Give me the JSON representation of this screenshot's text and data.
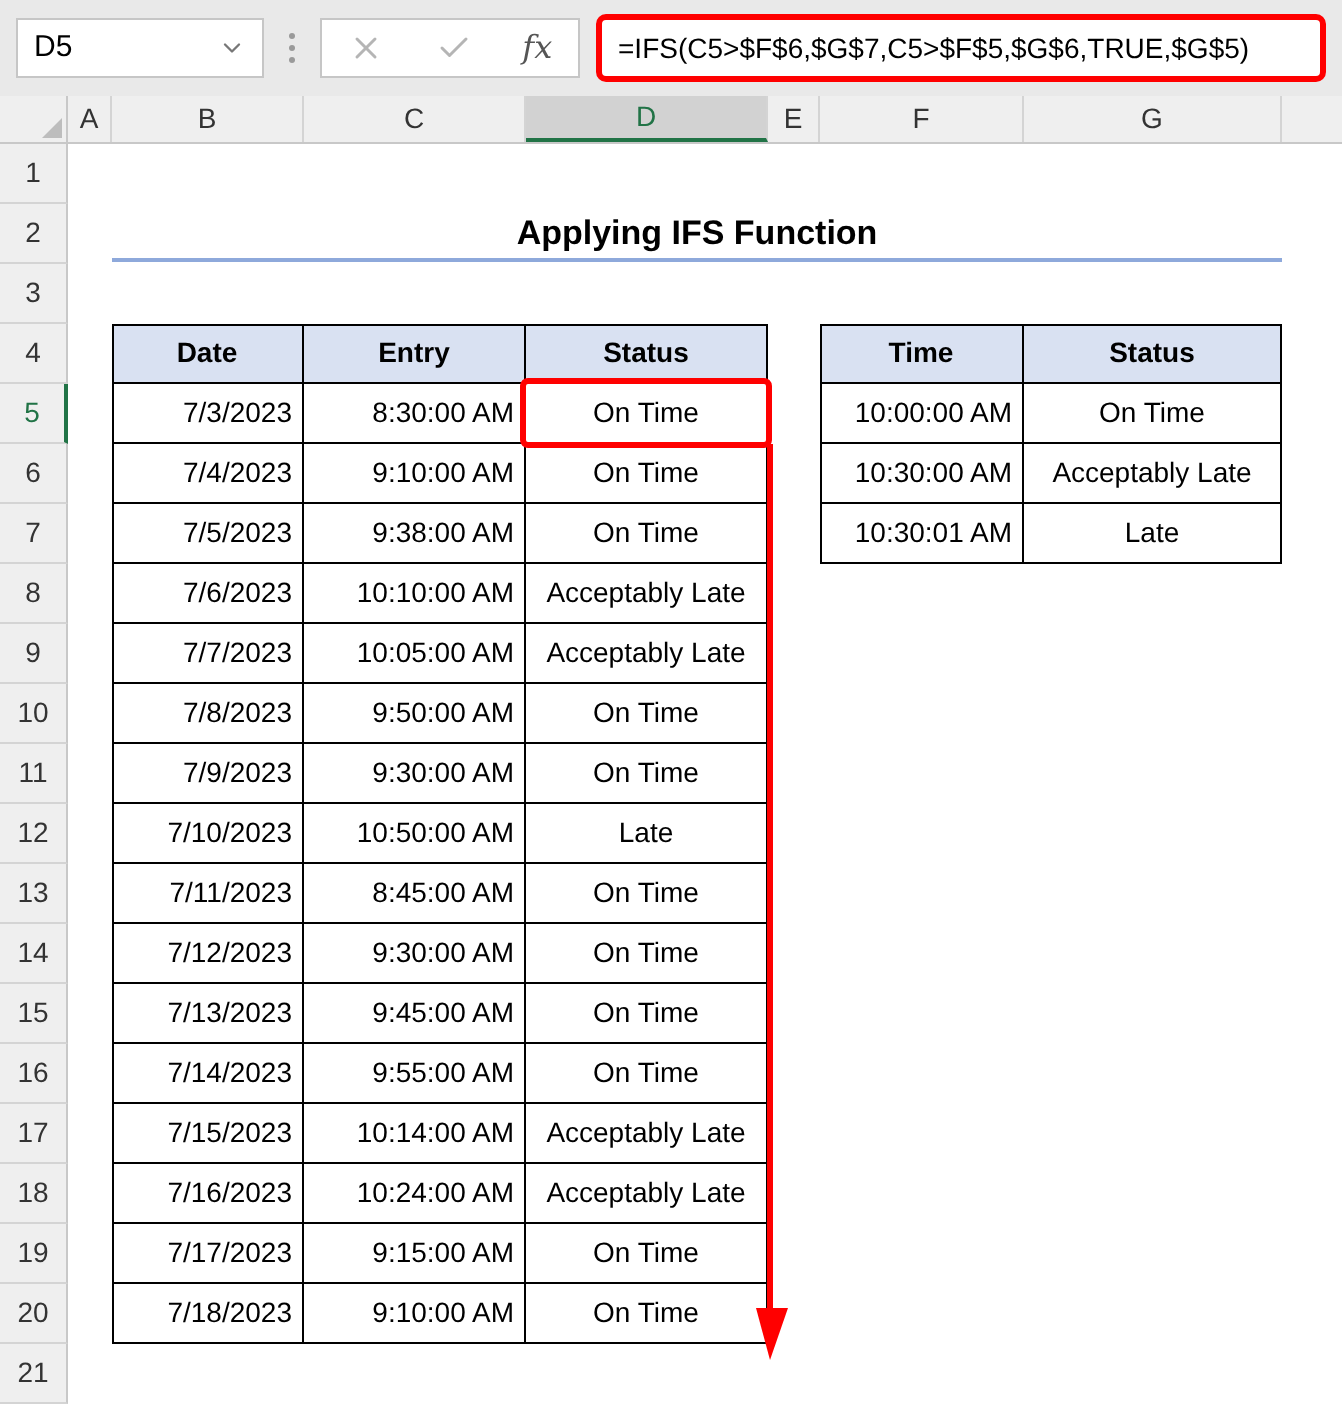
{
  "name_box": {
    "value": "D5"
  },
  "formula_bar": {
    "fx_label": "fx",
    "value": "=IFS(C5>$F$6,$G$7,C5>$F$5,$G$6,TRUE,$G$5)"
  },
  "columns": [
    {
      "label": "A",
      "selected": false
    },
    {
      "label": "B",
      "selected": false
    },
    {
      "label": "C",
      "selected": false
    },
    {
      "label": "D",
      "selected": true
    },
    {
      "label": "E",
      "selected": false
    },
    {
      "label": "F",
      "selected": false
    },
    {
      "label": "G",
      "selected": false
    }
  ],
  "rows": [
    {
      "label": "1",
      "selected": false
    },
    {
      "label": "2",
      "selected": false
    },
    {
      "label": "3",
      "selected": false
    },
    {
      "label": "4",
      "selected": false
    },
    {
      "label": "5",
      "selected": true
    },
    {
      "label": "6",
      "selected": false
    },
    {
      "label": "7",
      "selected": false
    },
    {
      "label": "8",
      "selected": false
    },
    {
      "label": "9",
      "selected": false
    },
    {
      "label": "10",
      "selected": false
    },
    {
      "label": "11",
      "selected": false
    },
    {
      "label": "12",
      "selected": false
    },
    {
      "label": "13",
      "selected": false
    },
    {
      "label": "14",
      "selected": false
    },
    {
      "label": "15",
      "selected": false
    },
    {
      "label": "16",
      "selected": false
    },
    {
      "label": "17",
      "selected": false
    },
    {
      "label": "18",
      "selected": false
    },
    {
      "label": "19",
      "selected": false
    },
    {
      "label": "20",
      "selected": false
    },
    {
      "label": "21",
      "selected": false
    }
  ],
  "title": "Applying IFS Function",
  "entries_table": {
    "columns": [
      "Date",
      "Entry",
      "Status"
    ],
    "rows": [
      [
        "7/3/2023",
        "8:30:00 AM",
        "On Time"
      ],
      [
        "7/4/2023",
        "9:10:00 AM",
        "On Time"
      ],
      [
        "7/5/2023",
        "9:38:00 AM",
        "On Time"
      ],
      [
        "7/6/2023",
        "10:10:00 AM",
        "Acceptably Late"
      ],
      [
        "7/7/2023",
        "10:05:00 AM",
        "Acceptably Late"
      ],
      [
        "7/8/2023",
        "9:50:00 AM",
        "On Time"
      ],
      [
        "7/9/2023",
        "9:30:00 AM",
        "On Time"
      ],
      [
        "7/10/2023",
        "10:50:00 AM",
        "Late"
      ],
      [
        "7/11/2023",
        "8:45:00 AM",
        "On Time"
      ],
      [
        "7/12/2023",
        "9:30:00 AM",
        "On Time"
      ],
      [
        "7/13/2023",
        "9:45:00 AM",
        "On Time"
      ],
      [
        "7/14/2023",
        "9:55:00 AM",
        "On Time"
      ],
      [
        "7/15/2023",
        "10:14:00 AM",
        "Acceptably Late"
      ],
      [
        "7/16/2023",
        "10:24:00 AM",
        "Acceptably Late"
      ],
      [
        "7/17/2023",
        "9:15:00 AM",
        "On Time"
      ],
      [
        "7/18/2023",
        "9:10:00 AM",
        "On Time"
      ]
    ]
  },
  "lookup_table": {
    "columns": [
      "Time",
      "Status"
    ],
    "rows": [
      [
        "10:00:00 AM",
        "On Time"
      ],
      [
        "10:30:00 AM",
        "Acceptably Late"
      ],
      [
        "10:30:01 AM",
        "Late"
      ]
    ]
  }
}
